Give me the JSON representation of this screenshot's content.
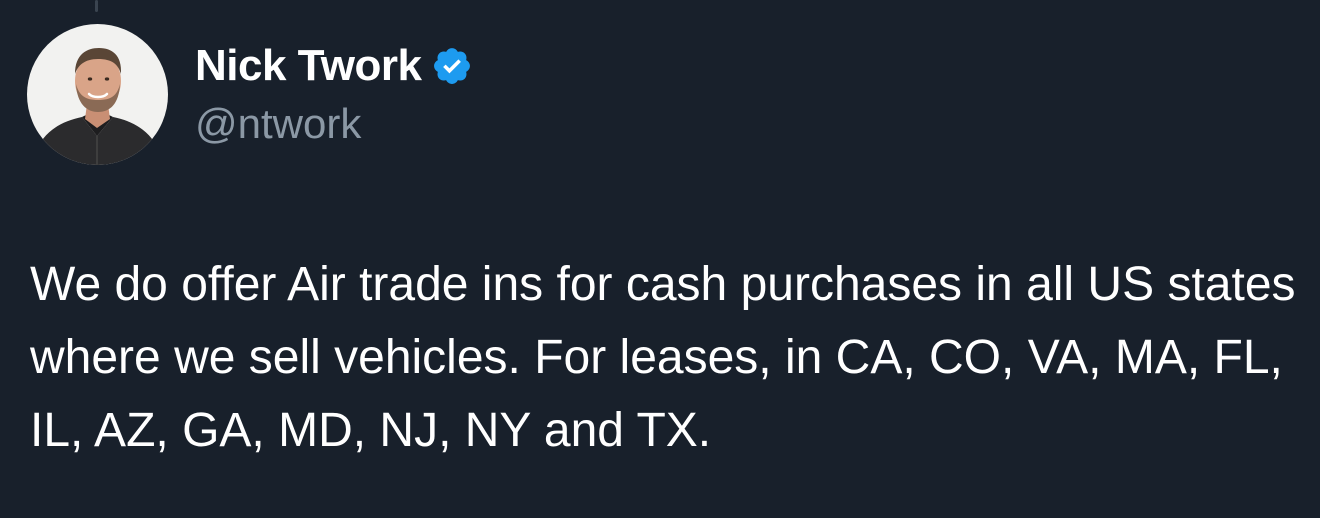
{
  "tweet": {
    "author": {
      "display_name": "Nick Twork",
      "handle": "@ntwork",
      "verified": true,
      "avatar": "profile-photo"
    },
    "text": "We do offer Air trade ins for cash purchases in all US states where we sell vehicles. For leases, in CA, CO, VA, MA, FL, IL, AZ, GA, MD, NJ, NY and TX."
  },
  "colors": {
    "background": "#18202b",
    "primary_text": "#ffffff",
    "secondary_text": "#8b98a5",
    "verified_badge": "#1d9bf0"
  },
  "icons": {
    "verified_badge": "verified-badge-icon"
  }
}
